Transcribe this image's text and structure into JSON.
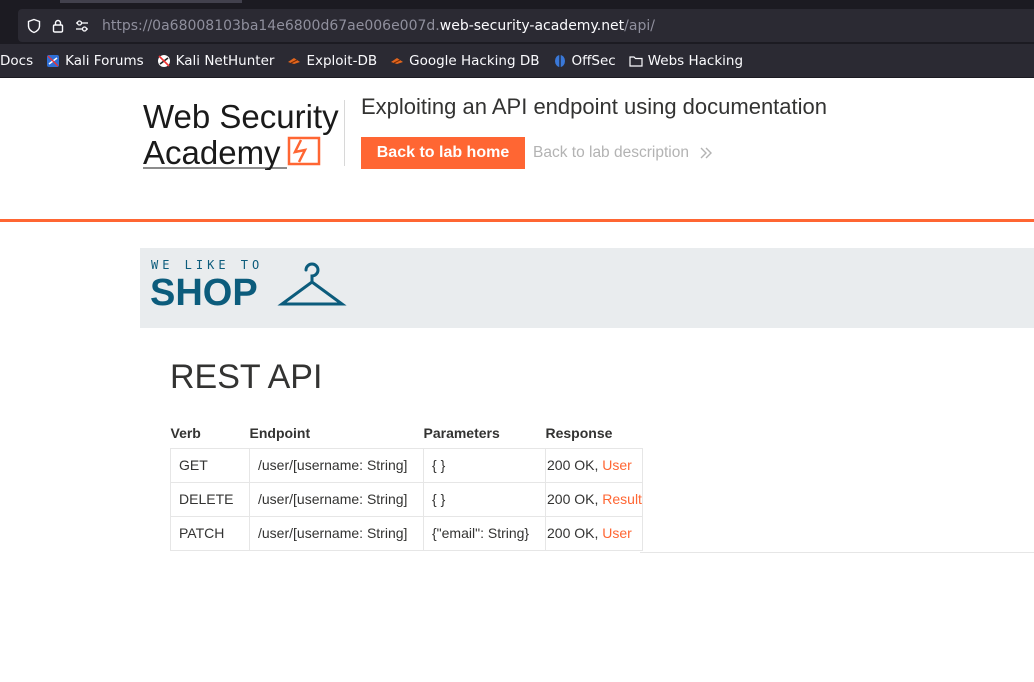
{
  "browser": {
    "url_prefix": "https://0a68008103ba14e6800d67ae006e007d.",
    "url_host": "web-security-academy.net",
    "url_path": "/api/",
    "bookmarks": [
      {
        "label": "Docs",
        "icon": "none"
      },
      {
        "label": "Kali Forums",
        "icon": "kali-forums-icon"
      },
      {
        "label": "Kali NetHunter",
        "icon": "kali-nethunter-icon"
      },
      {
        "label": "Exploit-DB",
        "icon": "exploit-db-icon"
      },
      {
        "label": "Google Hacking DB",
        "icon": "ghdb-icon"
      },
      {
        "label": "OffSec",
        "icon": "offsec-icon"
      },
      {
        "label": "Webs Hacking",
        "icon": "folder-icon"
      }
    ]
  },
  "header": {
    "logo_line1": "Web Security",
    "logo_line2": "Academy",
    "lab_title": "Exploiting an API endpoint using documentation",
    "back_home": "Back to lab home",
    "back_description": "Back to lab description"
  },
  "shop": {
    "tagline": "WE LIKE TO",
    "word": "SHOP"
  },
  "api": {
    "title": "REST API",
    "columns": [
      "Verb",
      "Endpoint",
      "Parameters",
      "Response"
    ],
    "rows": [
      {
        "verb": "GET",
        "endpoint": "/user/[username: String]",
        "params": "{ }",
        "status": "200 OK, ",
        "link": "User"
      },
      {
        "verb": "DELETE",
        "endpoint": "/user/[username: String]",
        "params": "{ }",
        "status": "200 OK, ",
        "link": "Result"
      },
      {
        "verb": "PATCH",
        "endpoint": "/user/[username: String]",
        "params": "{\"email\": String}",
        "status": "200 OK, ",
        "link": "User"
      }
    ]
  },
  "colors": {
    "accent": "#ff6633",
    "shop_blue": "#0c5c7c",
    "text": "#333332"
  }
}
